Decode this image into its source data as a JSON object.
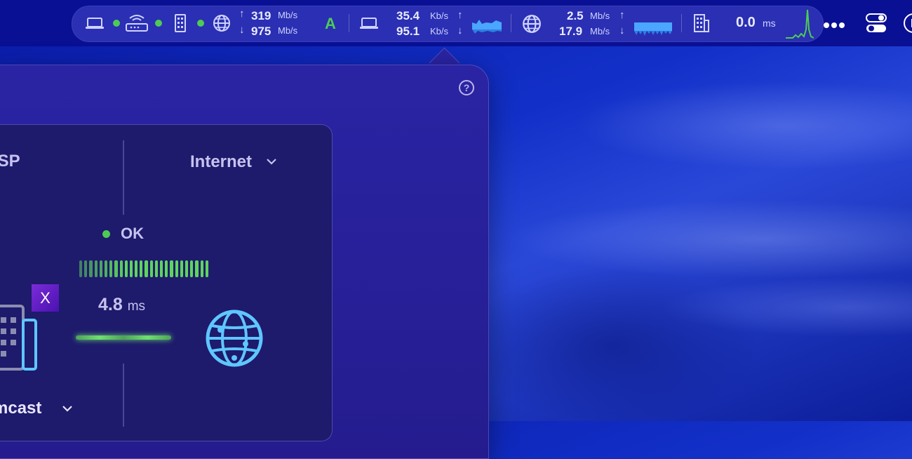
{
  "menubar": {
    "network": {
      "up_value": "319",
      "up_unit": "Mb/s",
      "down_value": "975",
      "down_unit": "Mb/s"
    },
    "app_letter": "A",
    "computer": {
      "up_value": "35.4",
      "up_unit": "Kb/s",
      "down_value": "95.1",
      "down_unit": "Kb/s"
    },
    "internet": {
      "up_value": "2.5",
      "up_unit": "Mb/s",
      "down_value": "17.9",
      "down_unit": "Mb/s"
    },
    "ping": {
      "value": "0.0",
      "unit": "ms"
    }
  },
  "popover": {
    "help_label": "?",
    "isp_header": "ISP",
    "internet_header": "Internet",
    "status": "OK",
    "latency_value": "4.8",
    "latency_unit": "ms",
    "isp_badge": "X",
    "isp_name": "mcast"
  },
  "colors": {
    "accent_green": "#4ecb54",
    "globe_blue": "#5fc6ff",
    "menubar": "#0a1094"
  }
}
